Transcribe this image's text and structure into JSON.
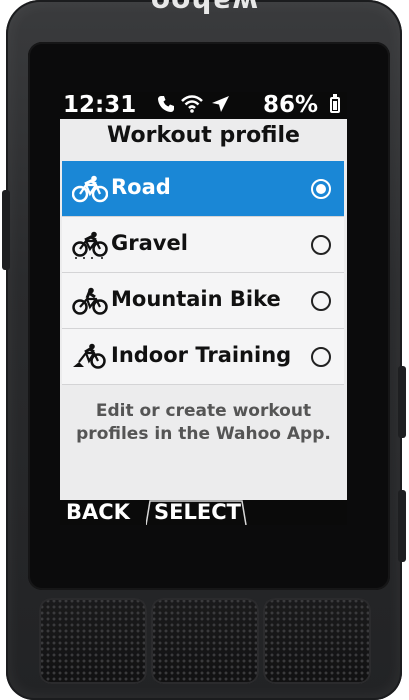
{
  "device": {
    "brand": "wahoo"
  },
  "status": {
    "time": "12:31",
    "battery_pct": "86%",
    "battery_level": 0.86,
    "icons": [
      "phone-icon",
      "wifi-icon",
      "location-arrow-icon",
      "battery-icon"
    ]
  },
  "screen": {
    "title": "Workout profile",
    "selected_index": 0,
    "profiles": [
      {
        "label": "Road",
        "icon": "road-bike-icon",
        "selected": true
      },
      {
        "label": "Gravel",
        "icon": "gravel-bike-icon",
        "selected": false
      },
      {
        "label": "Mountain Bike",
        "icon": "mountain-bike-icon",
        "selected": false
      },
      {
        "label": "Indoor Training",
        "icon": "indoor-trainer-icon",
        "selected": false
      }
    ],
    "hint": "Edit or create workout profiles in the Wahoo App."
  },
  "softkeys": {
    "back": "BACK",
    "select": "SELECT"
  },
  "colors": {
    "accent": "#1a87d6",
    "screen_bg": "#ececed",
    "bar_bg": "#0a0a0a",
    "body": "#2a2b2d"
  }
}
